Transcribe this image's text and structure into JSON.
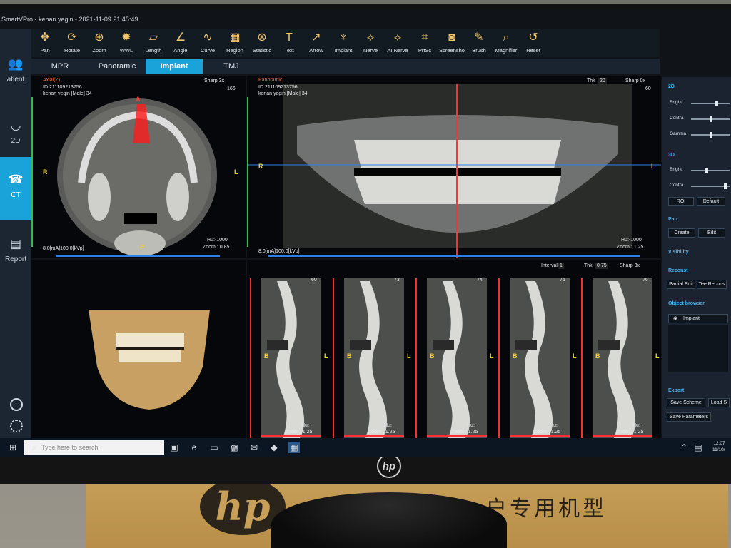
{
  "window": {
    "title": "SmartVPro - kenan yegin - 2021-11-09 21:45:49"
  },
  "sidebar": {
    "items": [
      {
        "label": "atient",
        "icon": "patient-icon"
      },
      {
        "label": "2D",
        "icon": "teeth-2d-icon"
      },
      {
        "label": "CT",
        "icon": "ct-icon"
      },
      {
        "label": "Report",
        "icon": "report-icon"
      }
    ]
  },
  "toolbar": {
    "tools": [
      {
        "label": "Pan",
        "icon": "✥"
      },
      {
        "label": "Rotate",
        "icon": "⟳"
      },
      {
        "label": "Zoom",
        "icon": "⊕"
      },
      {
        "label": "WWL",
        "icon": "✹"
      },
      {
        "label": "Length",
        "icon": "▱"
      },
      {
        "label": "Angle",
        "icon": "∠"
      },
      {
        "label": "Curve",
        "icon": "∿"
      },
      {
        "label": "Region",
        "icon": "▦"
      },
      {
        "label": "Statistic",
        "icon": "⊛"
      },
      {
        "label": "Text",
        "icon": "T"
      },
      {
        "label": "Arrow",
        "icon": "↗"
      },
      {
        "label": "Implant",
        "icon": "♆"
      },
      {
        "label": "Nerve",
        "icon": "⟡"
      },
      {
        "label": "AI Nerve",
        "icon": "⟡"
      },
      {
        "label": "PrtSc",
        "icon": "⌗"
      },
      {
        "label": "Screensho",
        "icon": "◙"
      },
      {
        "label": "Brush",
        "icon": "✎"
      },
      {
        "label": "Magnifier",
        "icon": "⌕"
      },
      {
        "label": "Reset",
        "icon": "↺"
      }
    ]
  },
  "tabs": [
    {
      "label": "MPR"
    },
    {
      "label": "Panoramic"
    },
    {
      "label": "Implant",
      "active": true
    },
    {
      "label": "TMJ"
    }
  ],
  "axial": {
    "title": "Axial(Z)",
    "sharp": "Sharp 3x",
    "slice": "166",
    "info": "ID:211109213756\nkenan yegin [Male] 34",
    "hu": "Hu:-1000",
    "zoom": "Zoom : 0.85",
    "exposure": "8.0[mA]100.0[kVp]",
    "l_right": "R",
    "l_left": "L",
    "l_top": "A",
    "l_bottom": "P"
  },
  "panoramic": {
    "title": "Panoramic",
    "thk_label": "Thk",
    "thk_value": "20",
    "sharp": "Sharp 0x",
    "slice": "60",
    "info": "ID:211109213756\nkenan yegin [Male] 34",
    "hu": "Hu:-1000",
    "zoom": "Zoom : 1.25",
    "exposure": "8.0[mA]100.0[kVp]",
    "l_right": "R",
    "l_left": "L"
  },
  "cross": {
    "interval_label": "Interval",
    "interval_value": "1",
    "thk_label": "Thk",
    "thk_value": "0.75",
    "sharp": "Sharp 3x",
    "slices": [
      {
        "num": "60",
        "hu": "Hu:-",
        "zoom": "Zoom : 1.25"
      },
      {
        "num": "73",
        "hu": "Hu:-",
        "zoom": "Zoom : 1.25"
      },
      {
        "num": "74",
        "hu": "Hu:-",
        "zoom": "Zoom : 1.25"
      },
      {
        "num": "75",
        "hu": "Hu:-",
        "zoom": "Zoom : 1.25"
      },
      {
        "num": "76",
        "hu": "Hu:-",
        "zoom": "Zoom : 1.25"
      }
    ],
    "l_b": "B",
    "l_l": "L"
  },
  "right_panel": {
    "sec_2d": "2D",
    "bright": "Bright",
    "contra": "Contra",
    "gamma": "Gamma",
    "sec_3d": "3D",
    "roi": "ROI",
    "default": "Default",
    "sec_pan": "Pan",
    "create": "Create",
    "edit": "Edit",
    "sec_visibility": "Visibility",
    "sec_reconst": "Reconst",
    "partial_edit": "Partial Edit",
    "tee_recons": "Tee Recons",
    "sec_object": "Object browser",
    "implant": "Implant",
    "sec_export": "Export",
    "save_scheme": "Save Scheme",
    "load": "Load S",
    "save_params": "Save Parameters"
  },
  "taskbar": {
    "search_placeholder": "Type here to search",
    "time": "12:07",
    "date": "11/10/"
  },
  "box_text": "户专用机型"
}
